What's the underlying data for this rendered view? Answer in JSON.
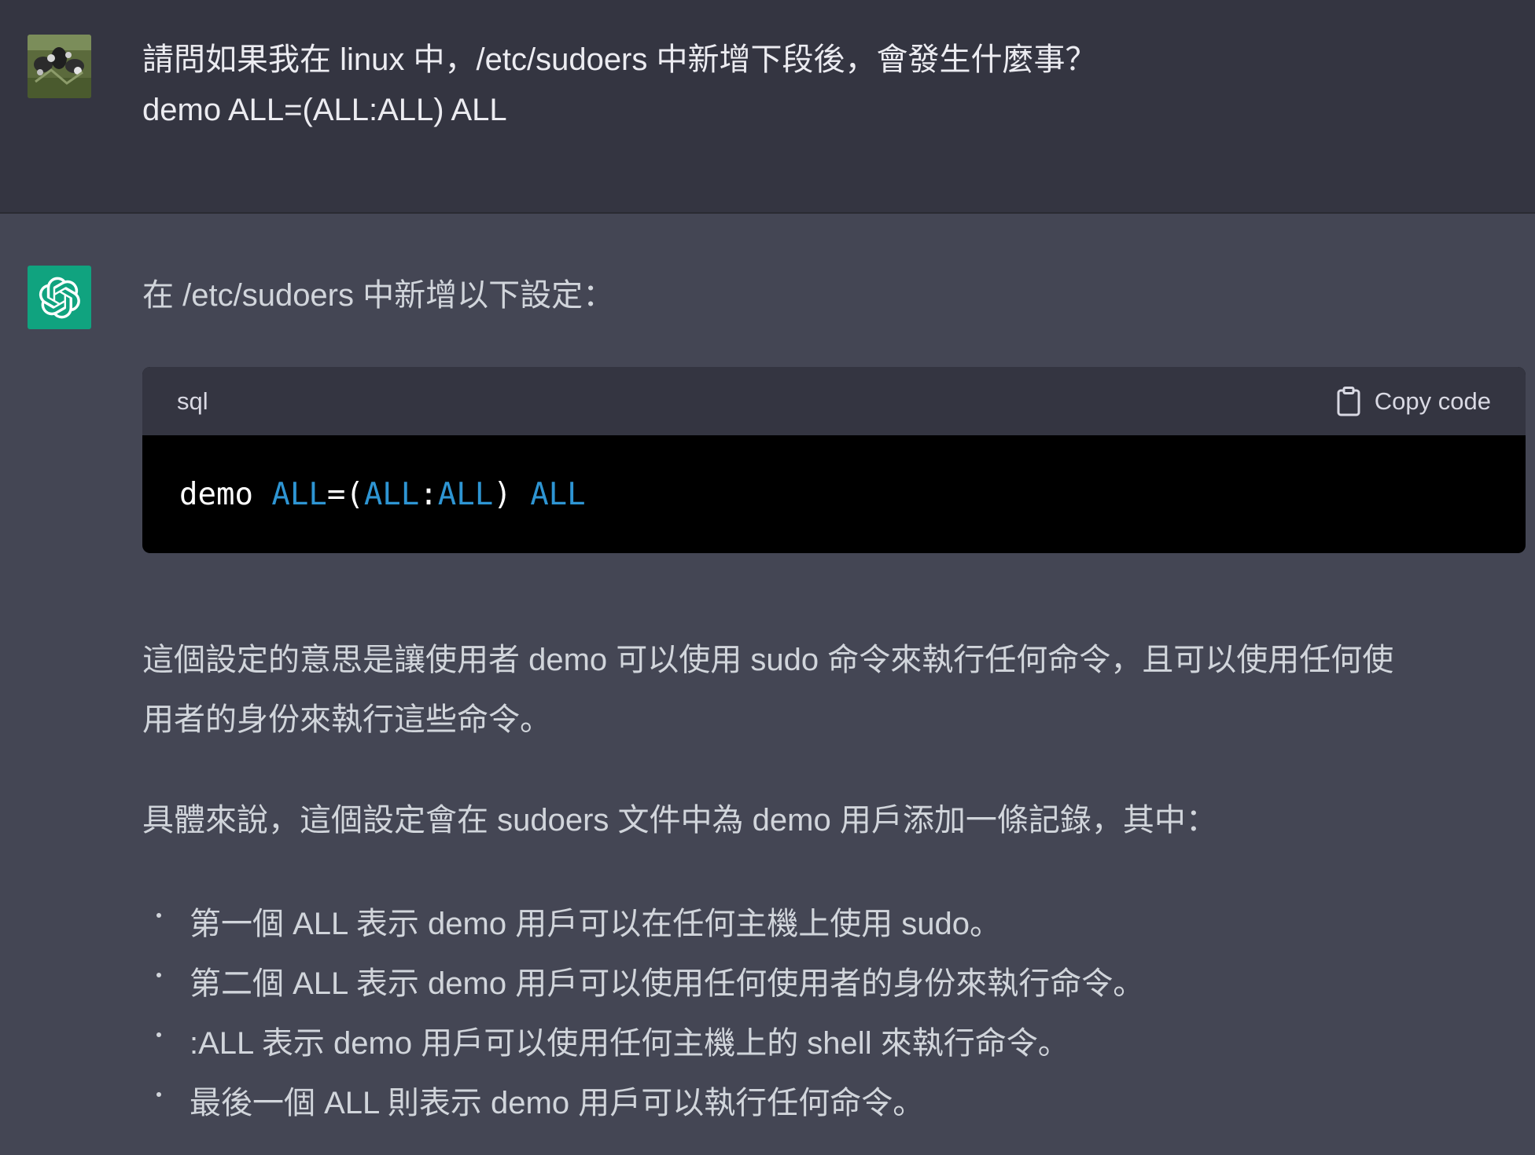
{
  "user_message": {
    "line1": "請問如果我在 linux 中，/etc/sudoers 中新增下段後，會發生什麼事？",
    "line2": "demo ALL=(ALL:ALL) ALL"
  },
  "assistant_message": {
    "intro": "在 /etc/sudoers 中新增以下設定：",
    "code_block": {
      "language": "sql",
      "copy_label": "Copy code",
      "tokens": [
        "demo ",
        "ALL",
        "=(",
        "ALL",
        ":",
        "ALL",
        ") ",
        "ALL"
      ]
    },
    "paragraph1_line1": "這個設定的意思是讓使用者 demo 可以使用 sudo 命令來執行任何命令，且可以使用任何使",
    "paragraph1_line2": "用者的身份來執行這些命令。",
    "paragraph2": "具體來說，這個設定會在 sudoers 文件中為 demo 用戶添加一條記錄，其中：",
    "bullets": [
      "第一個 ALL 表示 demo 用戶可以在任何主機上使用 sudo。",
      "第二個 ALL 表示 demo 用戶可以使用任何使用者的身份來執行命令。",
      ":ALL 表示 demo 用戶可以使用任何主機上的 shell 來執行命令。",
      "最後一個 ALL 則表示 demo 用戶可以執行任何命令。"
    ]
  },
  "colors": {
    "user_bg": "#343541",
    "assistant_bg": "#444654",
    "gpt_avatar_bg": "#10a37f",
    "code_keyword": "#2e95d3"
  },
  "icons": {
    "user_avatar": "user-photo-avatar",
    "assistant_avatar": "openai-logo-icon",
    "copy": "clipboard-icon"
  }
}
